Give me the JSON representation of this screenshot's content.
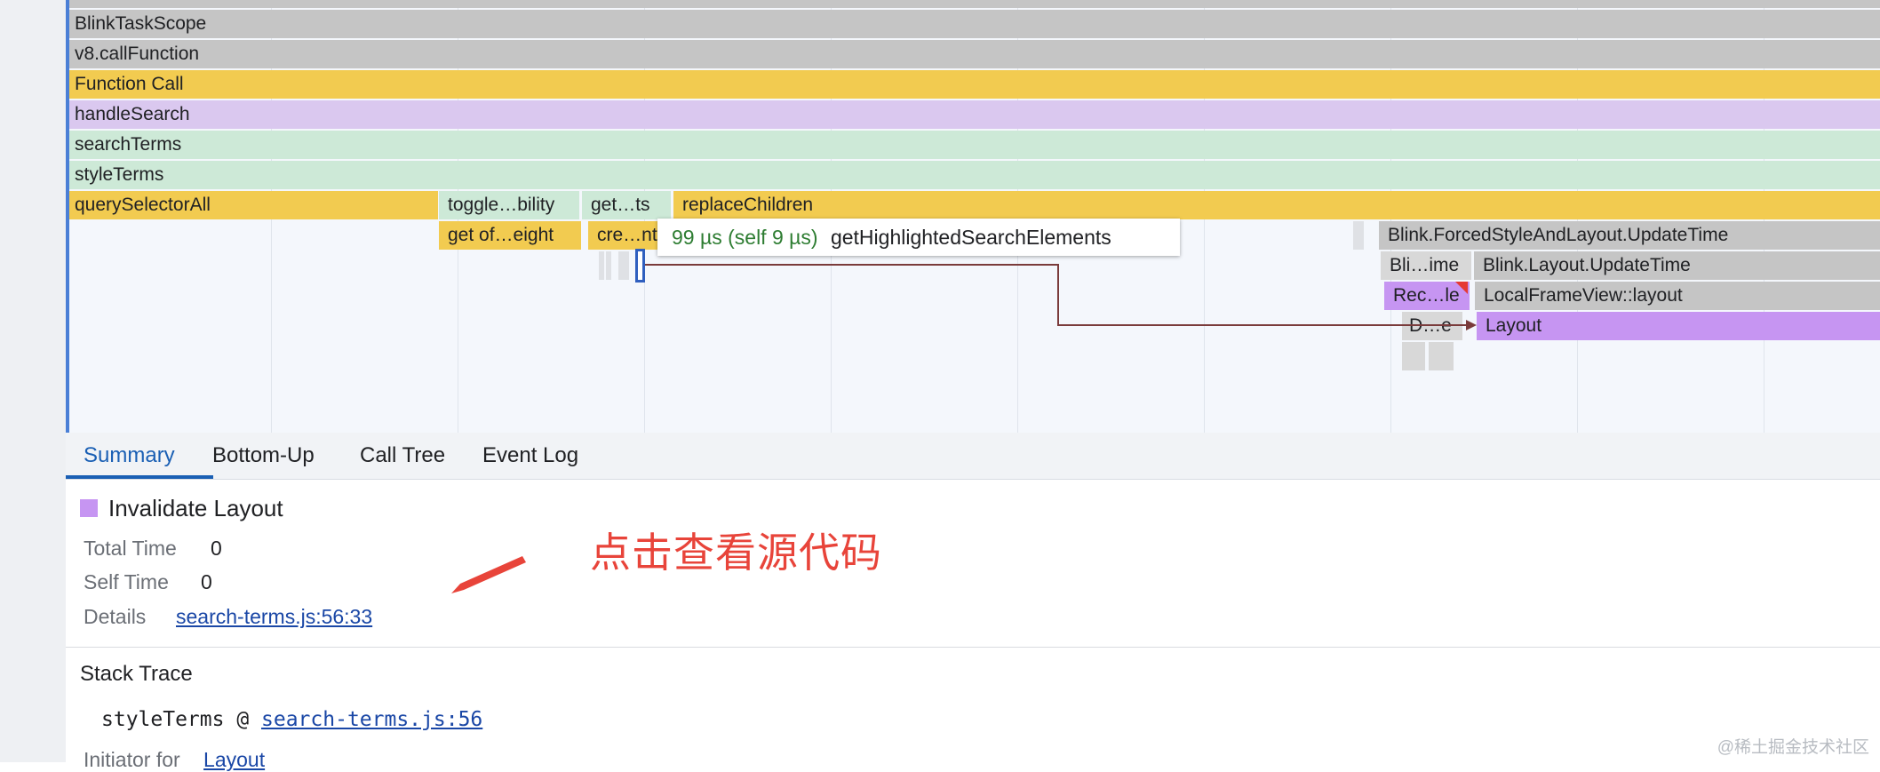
{
  "flame_chart": {
    "rows": [
      {
        "label": "BlinkTaskScope"
      },
      {
        "label": "v8.callFunction"
      },
      {
        "label": "Function Call"
      },
      {
        "label": "handleSearch"
      },
      {
        "label": "searchTerms"
      },
      {
        "label": "styleTerms"
      }
    ],
    "row7": {
      "query": "querySelectorAll",
      "toggle": "toggle…bility",
      "get": "get…ts",
      "replace": "replaceChildren"
    },
    "row8": {
      "getof": "get of…eight",
      "cre": "cre…nt",
      "forced": "Blink.ForcedStyleAndLayout.UpdateTime"
    },
    "row9": {
      "bli": "Bli…ime",
      "layout_update": "Blink.Layout.UpdateTime"
    },
    "row10": {
      "rec": "Rec…le",
      "lfv": "LocalFrameView::layout"
    },
    "row11": {
      "de": "D…e",
      "layout": "Layout"
    },
    "tooltip": {
      "time": "99 µs (self 9 µs)",
      "name": "getHighlightedSearchElements"
    }
  },
  "tabs": [
    {
      "label": "Summary",
      "active": true
    },
    {
      "label": "Bottom-Up"
    },
    {
      "label": "Call Tree"
    },
    {
      "label": "Event Log"
    }
  ],
  "summary": {
    "title": "Invalidate Layout",
    "swatch_color": "#c695f2",
    "total_time_label": "Total Time",
    "total_time_value": "0",
    "self_time_label": "Self Time",
    "self_time_value": "0",
    "details_label": "Details",
    "details_link": "search-terms.js:56:33"
  },
  "annotation": {
    "text": "点击查看源代码",
    "color": "#e8443a"
  },
  "stack_trace": {
    "title": "Stack Trace",
    "function": "styleTerms @ ",
    "link": "search-terms.js:56",
    "initiator_label": "Initiator for",
    "initiator_link": "Layout"
  },
  "watermark": "@稀土掘金技术社区"
}
